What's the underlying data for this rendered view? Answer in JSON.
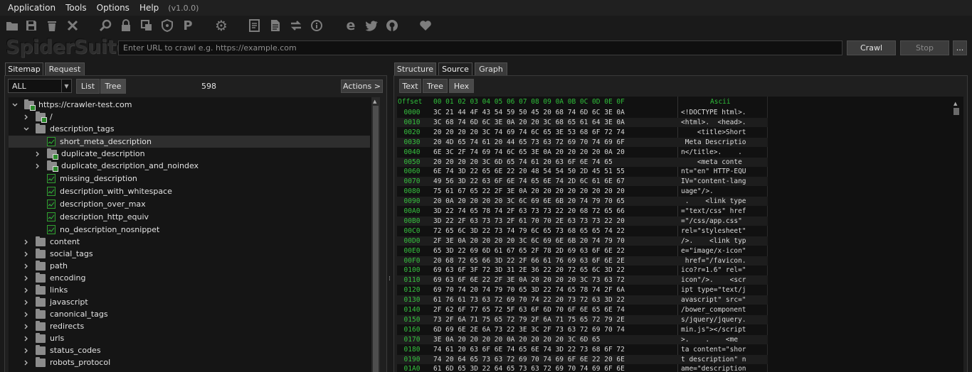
{
  "menu": {
    "items": [
      "Application",
      "Tools",
      "Options",
      "Help"
    ],
    "version": "(v1.0.0)"
  },
  "toolbar": {
    "icons": [
      "open-folder-icon",
      "save-icon",
      "trash-icon",
      "close-icon",
      "search-icon",
      "lock-icon",
      "copy-icon",
      "shield-icon",
      "proxy-p-icon",
      "gear-icon",
      "notes-icon",
      "document-icon",
      "refresh-icon",
      "info-icon",
      "browser-icon",
      "twitter-icon",
      "github-icon",
      "heart-icon"
    ]
  },
  "brand": {
    "part1": "Spider",
    "part2": "Suite"
  },
  "url_bar": {
    "placeholder": "Enter URL to crawl e.g. https://example.com",
    "value": ""
  },
  "buttons": {
    "crawl": "Crawl",
    "stop": "Stop",
    "more": "..."
  },
  "left_tabs": [
    "Sitemap",
    "Request"
  ],
  "filter": {
    "selected": "ALL"
  },
  "view_toggle": [
    "List",
    "Tree"
  ],
  "count": "598",
  "actions_button": "Actions >",
  "tree": [
    {
      "label": "https://crawler-test.com",
      "expander": "down",
      "icon": "folder-checked"
    },
    {
      "label": "/",
      "expander": "right",
      "icon": "folder-checked"
    },
    {
      "label": "description_tags",
      "expander": "down",
      "icon": "folder"
    },
    {
      "label": "short_meta_description",
      "expander": "",
      "icon": "page"
    },
    {
      "label": "duplicate_description",
      "expander": "right",
      "icon": "folder-checked"
    },
    {
      "label": "duplicate_description_and_noindex",
      "expander": "right",
      "icon": "folder-checked"
    },
    {
      "label": "missing_description",
      "expander": "",
      "icon": "page"
    },
    {
      "label": "description_with_whitespace",
      "expander": "",
      "icon": "page"
    },
    {
      "label": "description_over_max",
      "expander": "",
      "icon": "page"
    },
    {
      "label": "description_http_equiv",
      "expander": "",
      "icon": "page"
    },
    {
      "label": "no_description_nosnippet",
      "expander": "",
      "icon": "page"
    },
    {
      "label": "content",
      "expander": "right",
      "icon": "folder"
    },
    {
      "label": "social_tags",
      "expander": "right",
      "icon": "folder"
    },
    {
      "label": "path",
      "expander": "right",
      "icon": "folder"
    },
    {
      "label": "encoding",
      "expander": "right",
      "icon": "folder"
    },
    {
      "label": "links",
      "expander": "right",
      "icon": "folder"
    },
    {
      "label": "javascript",
      "expander": "right",
      "icon": "folder"
    },
    {
      "label": "canonical_tags",
      "expander": "right",
      "icon": "folder"
    },
    {
      "label": "redirects",
      "expander": "right",
      "icon": "folder"
    },
    {
      "label": "urls",
      "expander": "right",
      "icon": "folder"
    },
    {
      "label": "status_codes",
      "expander": "right",
      "icon": "folder"
    },
    {
      "label": "robots_protocol",
      "expander": "right",
      "icon": "folder"
    }
  ],
  "right_tabs": [
    "Structure",
    "Source",
    "Graph"
  ],
  "source_tabs": [
    "Text",
    "Tree",
    "Hex"
  ],
  "hex": {
    "offset_header": "Offset",
    "columns_header": "00 01 02 03 04 05 06 07 08 09 0A 0B 0C 0D 0E 0F",
    "ascii_header": "Ascii",
    "rows": [
      {
        "offset": "0000",
        "bytes": "3C 21 44 4F 43 54 59 50 45 20 68 74 6D 6C 3E 0A",
        "ascii": "<!DOCTYPE html>."
      },
      {
        "offset": "0010",
        "bytes": "3C 68 74 6D 6C 3E 0A 20 20 3C 68 65 61 64 3E 0A",
        "ascii": "<html>.  <head>."
      },
      {
        "offset": "0020",
        "bytes": "20 20 20 20 3C 74 69 74 6C 65 3E 53 68 6F 72 74",
        "ascii": "    <title>Short"
      },
      {
        "offset": "0030",
        "bytes": "20 4D 65 74 61 20 44 65 73 63 72 69 70 74 69 6F",
        "ascii": " Meta Descriptio"
      },
      {
        "offset": "0040",
        "bytes": "6E 3C 2F 74 69 74 6C 65 3E 0A 20 20 20 20 0A 20",
        "ascii": "n</title>.    . "
      },
      {
        "offset": "0050",
        "bytes": "20 20 20 20 3C 6D 65 74 61 20 63 6F 6E 74 65",
        "ascii": "    <meta conte"
      },
      {
        "offset": "0060",
        "bytes": "6E 74 3D 22 65 6E 22 20 48 54 54 50 2D 45 51 55",
        "ascii": "nt=\"en\" HTTP-EQU"
      },
      {
        "offset": "0070",
        "bytes": "49 56 3D 22 63 6F 6E 74 65 6E 74 2D 6C 61 6E 67",
        "ascii": "IV=\"content-lang"
      },
      {
        "offset": "0080",
        "bytes": "75 61 67 65 22 2F 3E 0A 20 20 20 20 20 20 20 20",
        "ascii": "uage\"/>.        "
      },
      {
        "offset": "0090",
        "bytes": "20 0A 20 20 20 20 3C 6C 69 6E 6B 20 74 79 70 65",
        "ascii": " .    <link type"
      },
      {
        "offset": "00A0",
        "bytes": "3D 22 74 65 78 74 2F 63 73 73 22 20 68 72 65 66",
        "ascii": "=\"text/css\" href"
      },
      {
        "offset": "00B0",
        "bytes": "3D 22 2F 63 73 73 2F 61 70 70 2E 63 73 73 22 20",
        "ascii": "=\"/css/app.css\" "
      },
      {
        "offset": "00C0",
        "bytes": "72 65 6C 3D 22 73 74 79 6C 65 73 68 65 65 74 22",
        "ascii": "rel=\"stylesheet\""
      },
      {
        "offset": "00D0",
        "bytes": "2F 3E 0A 20 20 20 20 3C 6C 69 6E 6B 20 74 79 70",
        "ascii": "/>.    <link typ"
      },
      {
        "offset": "00E0",
        "bytes": "65 3D 22 69 6D 61 67 65 2F 78 2D 69 63 6F 6E 22",
        "ascii": "e=\"image/x-icon\""
      },
      {
        "offset": "00F0",
        "bytes": "20 68 72 65 66 3D 22 2F 66 61 76 69 63 6F 6E 2E",
        "ascii": " href=\"/favicon."
      },
      {
        "offset": "0100",
        "bytes": "69 63 6F 3F 72 3D 31 2E 36 22 20 72 65 6C 3D 22",
        "ascii": "ico?r=1.6\" rel=\""
      },
      {
        "offset": "0110",
        "bytes": "69 63 6F 6E 22 2F 3E 0A 20 20 20 20 3C 73 63 72",
        "ascii": "icon\"/>.    <scr"
      },
      {
        "offset": "0120",
        "bytes": "69 70 74 20 74 79 70 65 3D 22 74 65 78 74 2F 6A",
        "ascii": "ipt type=\"text/j"
      },
      {
        "offset": "0130",
        "bytes": "61 76 61 73 63 72 69 70 74 22 20 73 72 63 3D 22",
        "ascii": "avascript\" src=\""
      },
      {
        "offset": "0140",
        "bytes": "2F 62 6F 77 65 72 5F 63 6F 6D 70 6F 6E 65 6E 74",
        "ascii": "/bower_component"
      },
      {
        "offset": "0150",
        "bytes": "73 2F 6A 71 75 65 72 79 2F 6A 71 75 65 72 79 2E",
        "ascii": "s/jquery/jquery."
      },
      {
        "offset": "0160",
        "bytes": "6D 69 6E 2E 6A 73 22 3E 3C 2F 73 63 72 69 70 74",
        "ascii": "min.js\"></script"
      },
      {
        "offset": "0170",
        "bytes": "3E 0A 20 20 20 20 0A 20 20 20 20 3C 6D 65",
        "ascii": ">.    .    <me"
      },
      {
        "offset": "0180",
        "bytes": "74 61 20 63 6F 6E 74 65 6E 74 3D 22 73 68 6F 72",
        "ascii": "ta content=\"shor"
      },
      {
        "offset": "0190",
        "bytes": "74 20 64 65 73 63 72 69 70 74 69 6F 6E 22 20 6E",
        "ascii": "t description\" n"
      },
      {
        "offset": "01A0",
        "bytes": "61 6D 65 3D 22 64 65 73 63 72 69 70 74 69 6F 6E",
        "ascii": "ame=\"description"
      }
    ]
  }
}
